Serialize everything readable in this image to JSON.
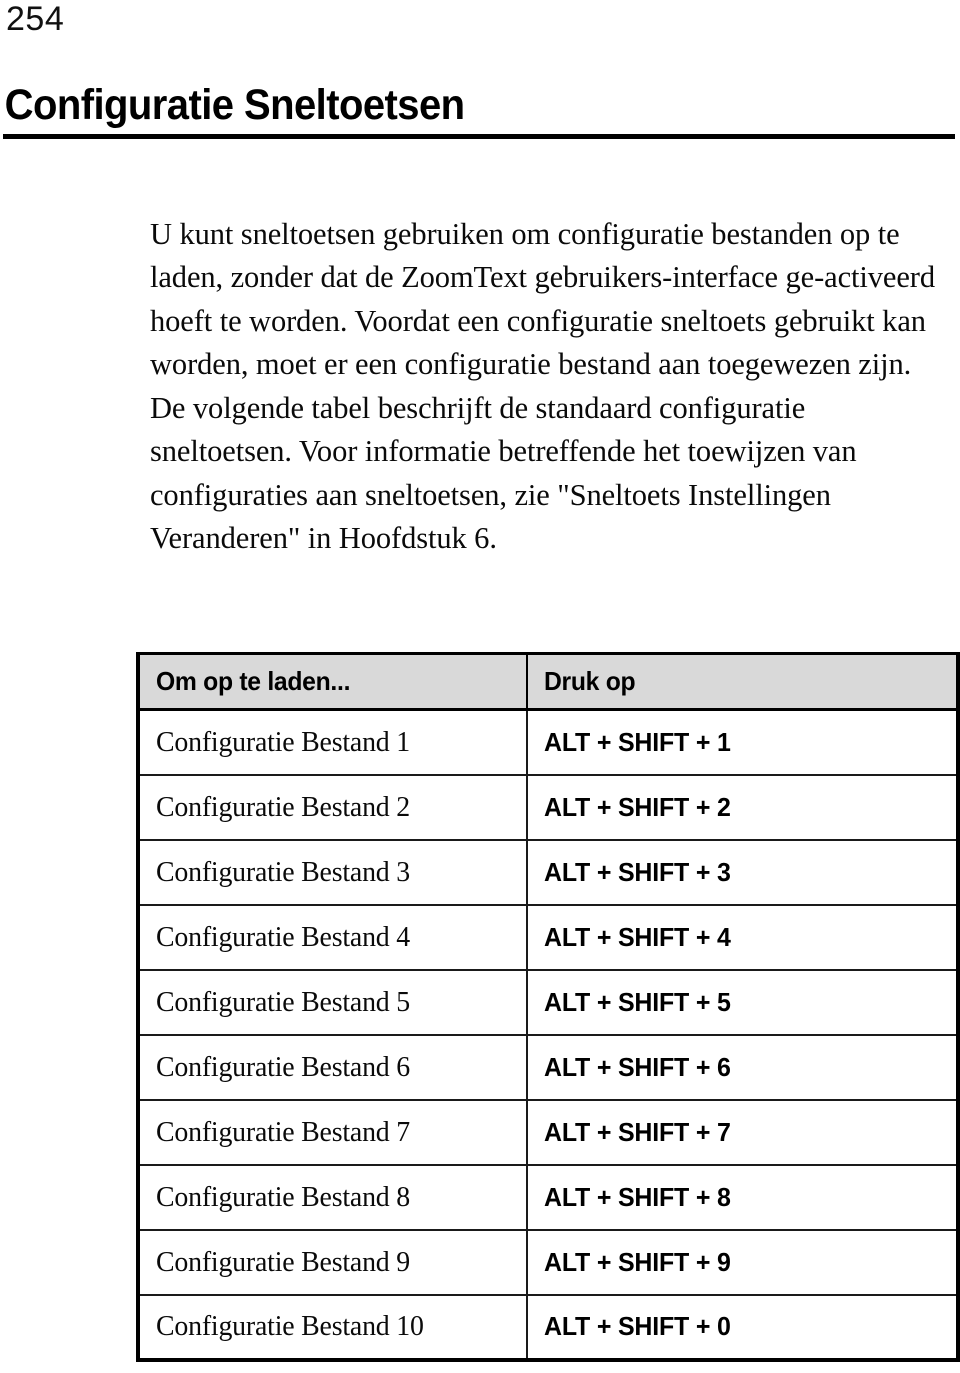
{
  "page": {
    "number": "254"
  },
  "heading": {
    "title": "Configuratie Sneltoetsen"
  },
  "body": {
    "paragraph": "U kunt sneltoetsen gebruiken om configuratie bestanden op te laden, zonder dat de ZoomText gebruikers-interface ge-activeerd hoeft te worden. Voordat een configuratie sneltoets gebruikt kan worden, moet er een configuratie bestand aan toegewezen zijn. De volgende tabel beschrijft de standaard configuratie sneltoetsen. Voor informatie betreffende het toewijzen van configuraties aan sneltoetsen, zie \"Sneltoets Instellingen Veranderen\" in Hoofdstuk 6."
  },
  "table": {
    "headers": {
      "action": "Om op te laden...",
      "keys": "Druk op"
    },
    "rows": [
      {
        "action": "Configuratie Bestand 1",
        "keys": "ALT + SHIFT + 1"
      },
      {
        "action": "Configuratie Bestand 2",
        "keys": "ALT + SHIFT + 2"
      },
      {
        "action": "Configuratie Bestand 3",
        "keys": "ALT + SHIFT + 3"
      },
      {
        "action": "Configuratie Bestand 4",
        "keys": "ALT + SHIFT + 4"
      },
      {
        "action": "Configuratie Bestand 5",
        "keys": "ALT + SHIFT + 5"
      },
      {
        "action": "Configuratie Bestand 6",
        "keys": "ALT + SHIFT + 6"
      },
      {
        "action": "Configuratie Bestand 7",
        "keys": "ALT + SHIFT + 7"
      },
      {
        "action": "Configuratie Bestand 8",
        "keys": "ALT + SHIFT + 8"
      },
      {
        "action": "Configuratie Bestand 9",
        "keys": "ALT + SHIFT + 9"
      },
      {
        "action": "Configuratie Bestand 10",
        "keys": "ALT + SHIFT + 0"
      }
    ]
  },
  "colors": {
    "text": "#000000",
    "header_fill": "#d9d9d9",
    "rule": "#000000"
  }
}
